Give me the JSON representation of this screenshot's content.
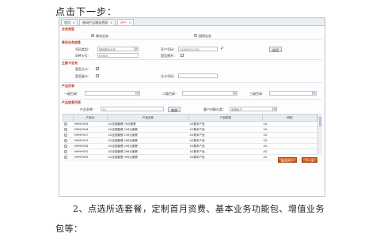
{
  "doc": {
    "intro": "点击下一步：",
    "step2": "2、点选所选套餐，定制首月资费、基本业务功能包、增值业务",
    "step2_cont": "包等："
  },
  "ui": {
    "tabs": [
      {
        "label": "首页",
        "close": "x"
      },
      {
        "label": "新网产品服务界面",
        "close": "x"
      },
      {
        "label": "开户",
        "close": "x"
      }
    ],
    "business_type": {
      "title": "业务类型",
      "option_mobile": "移动业务",
      "option_fixed": "固网业务"
    },
    "mobile_info": {
      "title": "移动业务信息",
      "number_type_label": "号码类型：",
      "number_type_value": "固网移动业务",
      "sim_label": "SIM卡号：",
      "sim_value": "89860",
      "user_number_label": "开户号码：",
      "user_number_value": "15962622238",
      "check_icon": "✔",
      "select_button": "选号",
      "pre_card_label": "是否预开："
    },
    "extra": {
      "title": "主副卡业务",
      "is_main_label": "是否主卡：",
      "is_sub_label": "是否副卡：",
      "main_number_label": "主卡号码："
    },
    "product_tree": {
      "title": "产品目录",
      "level1_label": "一级目录：",
      "level2_label": "二级目录：",
      "level3_label": "三级目录："
    },
    "product_list": {
      "title": "产品信息列表",
      "product_name_label": "产品名称：",
      "product_name_value": "3G",
      "query_button": "查询",
      "user_category_label": "客户对象分类：",
      "user_category_value": "普通用户",
      "columns": [
        "",
        "产品ID",
        "产品名称",
        "产品类型",
        "网别"
      ],
      "rows": [
        {
          "id": "99999926",
          "name": "4G全国套餐-76元套餐",
          "type": "4G基本产品",
          "net": "4G"
        },
        {
          "id": "99999918",
          "name": "4G全国套餐-106元套餐",
          "type": "4G基本产品",
          "net": "4G"
        },
        {
          "id": "99999927",
          "name": "4G全国套餐-136元套餐",
          "type": "4G基本产品",
          "net": "4G"
        },
        {
          "id": "99999919",
          "name": "4G全国套餐-166元套餐",
          "type": "4G基本产品",
          "net": "4G"
        },
        {
          "id": "99999928",
          "name": "4G全国套餐-196元套餐",
          "type": "4G基本产品",
          "net": "4G"
        },
        {
          "id": "99999920",
          "name": "4G全国套餐-296元套餐",
          "type": "4G基本产品",
          "net": "4G"
        },
        {
          "id": "99999929",
          "name": "4G全国套餐-396元套餐",
          "type": "4G基本产品",
          "net": "4G"
        }
      ]
    },
    "footer": {
      "prev_button": "取消开户",
      "next_button": "下一步"
    }
  }
}
